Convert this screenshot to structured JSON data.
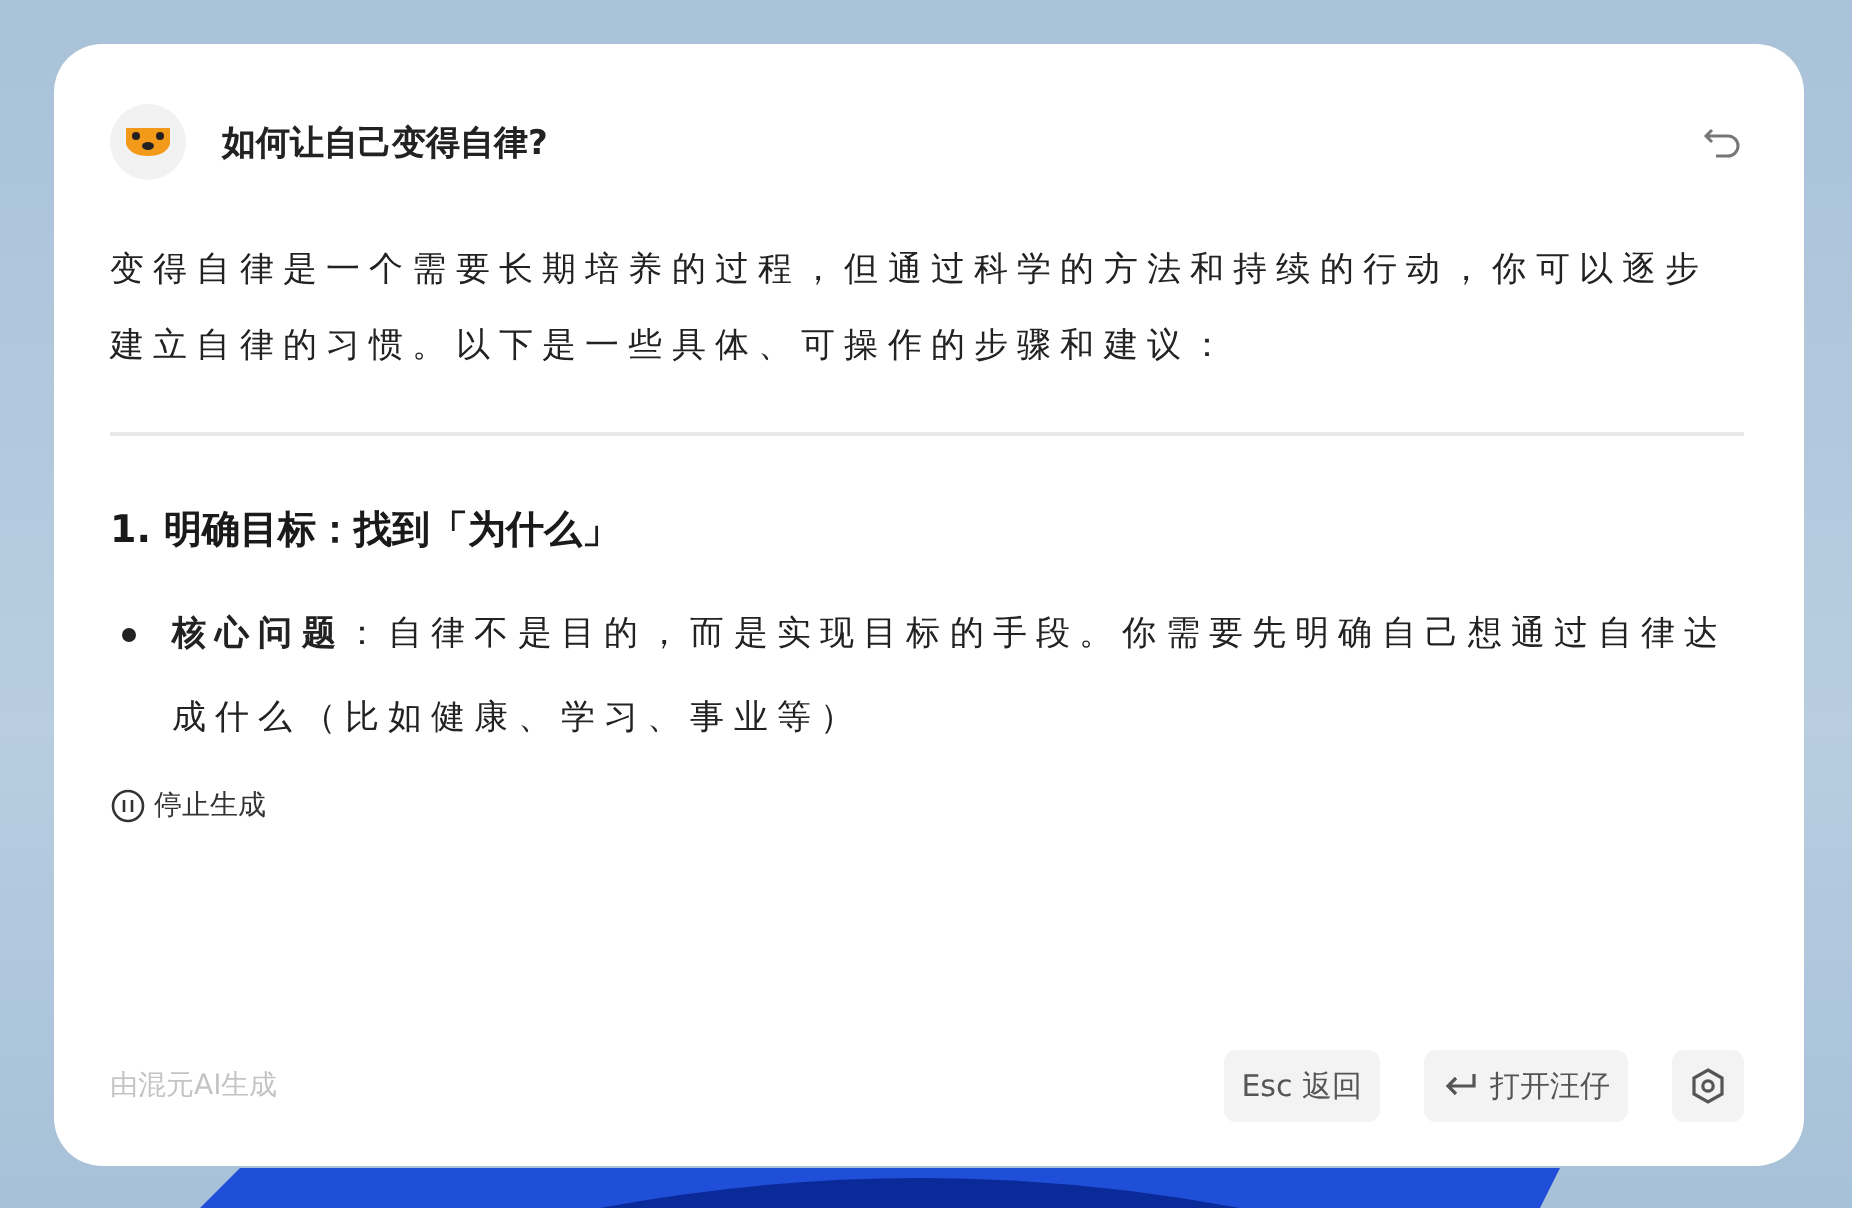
{
  "question": "如何让自己变得自律?",
  "intro": "变得自律是一个需要长期培养的过程，但通过科学的方法和持续的行动，你可以逐步建立自律的习惯。以下是一些具体、可操作的步骤和建议：",
  "section_heading": "1. 明确目标：找到「为什么」",
  "bullets": [
    "**核心问题**：自律不是目的，而是实现目标的手段。你需要先明确自己想通过自律达成什么（比如健康、学习、事业等）"
  ],
  "stop_button": "停止生成",
  "footer_note": "由混元AI生成",
  "buttons": [
    {
      "kind": "text",
      "label": "Esc 返回"
    },
    {
      "kind": "enter",
      "label": "打开汪仔"
    },
    {
      "kind": "settings"
    }
  ]
}
